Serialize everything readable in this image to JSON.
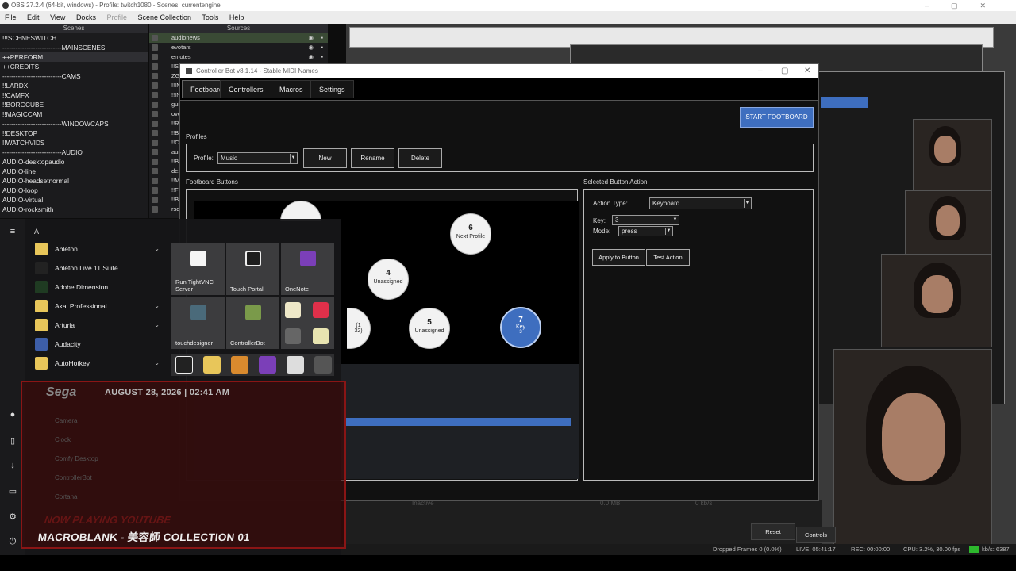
{
  "obs": {
    "title": "OBS 27.2.4 (64-bit, windows) - Profile: twitch1080 - Scenes: currentengine",
    "menu": [
      "File",
      "Edit",
      "View",
      "Docks",
      "Profile",
      "Scene Collection",
      "Tools",
      "Help"
    ],
    "scenes_header": "Scenes",
    "sources_header": "Sources",
    "scenes": [
      "!!!SCENESWITCH",
      "---------------------------MAINSCENES",
      "++PERFORM",
      "++CREDITS",
      "---------------------------CAMS",
      "!!LARDX",
      "!!CAMFX",
      "!!BORGCUBE",
      "!!MAGICCAM",
      "---------------------------WINDOWCAPS",
      "!!DESKTOP",
      "!!WATCHVIDS",
      "---------------------------AUDIO",
      "AUDIO-desktopaudio",
      "AUDIO-line",
      "AUDIO-headsetnormal",
      "AUDIO-loop",
      "AUDIO-virtual",
      "AUDIO-rocksmith"
    ],
    "sources": [
      "audionews",
      "evotars",
      "emotes",
      "!!SMOK",
      "ZGRE",
      "!!INFO",
      "!!INST",
      "guitar",
      "ove",
      "!!RSS",
      "!!BIGI",
      "!!CAM",
      "auroc",
      "!!BOR",
      "des",
      "!!MAC",
      "!!FX",
      "!!BAC",
      "rsdic"
    ],
    "status_dropped": "Dropped Frames 0 (0.0%)",
    "status_live": "LIVE: 05:41:17",
    "status_rec": "REC: 00:00:00",
    "status_cpu": "CPU: 3.2%, 30.00 fps",
    "status_kbps": "kb/s: 6387",
    "reset_label": "Reset",
    "controls_label": "Controls",
    "inactive_label": "Inactive",
    "bw_label": "0.0 MB",
    "kbps_label": "0 kb/s"
  },
  "controller_bot": {
    "title": "Controller Bot v8.1.14 - Stable MIDI Names",
    "tabs": [
      "Footboard",
      "Controllers",
      "Macros",
      "Settings"
    ],
    "start_button": "START FOOTBOARD",
    "profiles_label": "Profiles",
    "profile_label": "Profile:",
    "profile_value": "Music",
    "new_button": "New",
    "rename_button": "Rename",
    "delete_button": "Delete",
    "footboard_buttons_label": "Footboard Buttons",
    "selected_action_label": "Selected Button Action",
    "action_type_label": "Action Type:",
    "action_type_value": "Keyboard",
    "key_label": "Key:",
    "key_value": "3",
    "mode_label": "Mode:",
    "mode_value": "press",
    "apply_button": "Apply to Button",
    "test_button": "Test Action",
    "footboard": [
      {
        "num": "6",
        "label": "Next Profile"
      },
      {
        "num": "4",
        "label": "Unassigned"
      },
      {
        "num": "5",
        "label": "Unassigned"
      },
      {
        "num": "7",
        "label": "Key",
        "sub": "3"
      }
    ],
    "partial_button_label": "(1",
    "partial_button_sub": "32)"
  },
  "start_menu": {
    "letter": "A",
    "apps": [
      {
        "label": "Ableton",
        "expandable": true,
        "color": "#e8c65a"
      },
      {
        "label": "Ableton Live 11 Suite",
        "expandable": false,
        "color": "#222222"
      },
      {
        "label": "Adobe Dimension",
        "expandable": false,
        "color": "#1f3b22"
      },
      {
        "label": "Akai Professional",
        "expandable": true,
        "color": "#e8c65a"
      },
      {
        "label": "Arturia",
        "expandable": true,
        "color": "#e8c65a"
      },
      {
        "label": "Audacity",
        "expandable": false,
        "color": "#3d5ea8"
      },
      {
        "label": "AutoHotkey",
        "expandable": true,
        "color": "#e8c65a"
      }
    ],
    "tiles": [
      {
        "label": "Run TightVNC Server",
        "color": "#f5f5f5"
      },
      {
        "label": "Touch Portal",
        "color": "#1e1e1e"
      },
      {
        "label": "OneNote",
        "color": "#7b3fb8"
      },
      {
        "label": "touchdesigner",
        "color": "#4a6a7a"
      },
      {
        "label": "ControllerBot",
        "color": "#7a9a4a"
      }
    ],
    "ghost_items": [
      "Camera",
      "Clock",
      "Comfy Desktop",
      "ControllerBot",
      "Cortana"
    ]
  },
  "overlay": {
    "brand": "Sega",
    "date": "AUGUST 28, 2026 | 02:41 AM",
    "now_playing": "NOW PLAYING YOUTUBE",
    "track": "MACROBLANK - 美容師 COLLECTION 01"
  },
  "colors": {
    "accent": "#3e6ebf",
    "panel": "#111111",
    "banner": "#8a1515"
  }
}
